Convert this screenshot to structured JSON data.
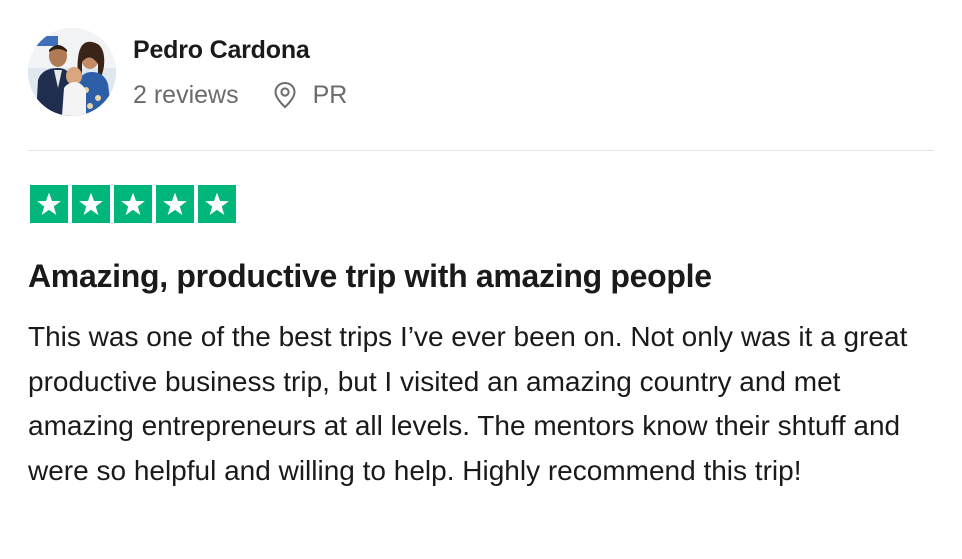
{
  "reviewer": {
    "name": "Pedro Cardona",
    "review_count": "2 reviews",
    "location": "PR",
    "avatar_icon": "user-photo-avatar"
  },
  "rating": {
    "stars": 5,
    "max_stars": 5,
    "star_color": "#00b67a",
    "icon": "star-icon"
  },
  "review": {
    "title": "Amazing, productive trip with amazing people",
    "body": "This was one of the best trips I’ve ever been on. Not only was it a great productive business trip, but I visited an amazing country and met amazing entrepreneurs at all levels. The mentors know their shtuff and were so helpful and willing to help. Highly recommend this trip!"
  },
  "colors": {
    "text": "#1a1a1a",
    "muted": "#6b6b6b",
    "divider": "#e4e4e4"
  }
}
